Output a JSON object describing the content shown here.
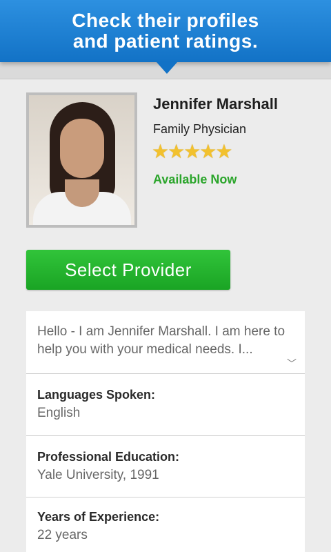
{
  "banner": {
    "line1": "Check their profiles",
    "line2": "and patient ratings."
  },
  "provider": {
    "name": "Jennifer Marshall",
    "specialty": "Family Physician",
    "rating_stars": 5,
    "stars_text": "★★★★★",
    "availability": "Available Now",
    "select_label": "Select Provider",
    "bio": "Hello - I am Jennifer Marshall. I am here to help you with your medical needs. I..."
  },
  "details": [
    {
      "label": "Languages Spoken:",
      "value": "English"
    },
    {
      "label": "Professional Education:",
      "value": "Yale University, 1991"
    },
    {
      "label": "Years of Experience:",
      "value": "22 years"
    }
  ],
  "colors": {
    "banner": "#1a7fd4",
    "available": "#2ba52b",
    "select_button": "#22b12c",
    "star": "#f2c12e"
  },
  "icons": [
    "back-arrow-icon",
    "wifi-icon",
    "star-icon",
    "chevron-down-icon"
  ]
}
